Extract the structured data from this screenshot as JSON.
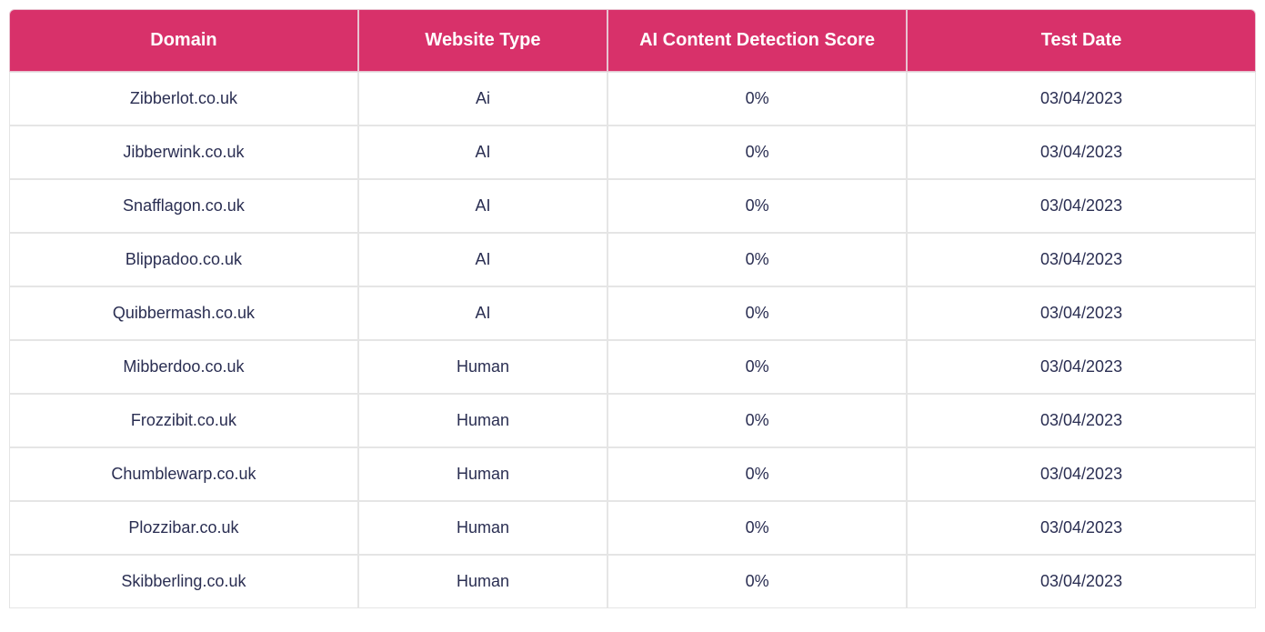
{
  "chart_data": {
    "type": "table",
    "headers": [
      "Domain",
      "Website Type",
      "AI Content Detection Score",
      "Test Date"
    ],
    "rows": [
      {
        "domain": "Zibberlot.co.uk",
        "type": "Ai",
        "score": "0%",
        "date": "03/04/2023"
      },
      {
        "domain": "Jibberwink.co.uk",
        "type": "AI",
        "score": "0%",
        "date": "03/04/2023"
      },
      {
        "domain": "Snafflagon.co.uk",
        "type": "AI",
        "score": "0%",
        "date": "03/04/2023"
      },
      {
        "domain": "Blippadoo.co.uk",
        "type": "AI",
        "score": "0%",
        "date": "03/04/2023"
      },
      {
        "domain": "Quibbermash.co.uk",
        "type": "AI",
        "score": "0%",
        "date": "03/04/2023"
      },
      {
        "domain": "Mibberdoo.co.uk",
        "type": "Human",
        "score": "0%",
        "date": "03/04/2023"
      },
      {
        "domain": "Frozzibit.co.uk",
        "type": "Human",
        "score": "0%",
        "date": "03/04/2023"
      },
      {
        "domain": "Chumblewarp.co.uk",
        "type": "Human",
        "score": "0%",
        "date": "03/04/2023"
      },
      {
        "domain": "Plozzibar.co.uk",
        "type": "Human",
        "score": "0%",
        "date": "03/04/2023"
      },
      {
        "domain": "Skibberling.co.uk",
        "type": "Human",
        "score": "0%",
        "date": "03/04/2023"
      }
    ]
  }
}
